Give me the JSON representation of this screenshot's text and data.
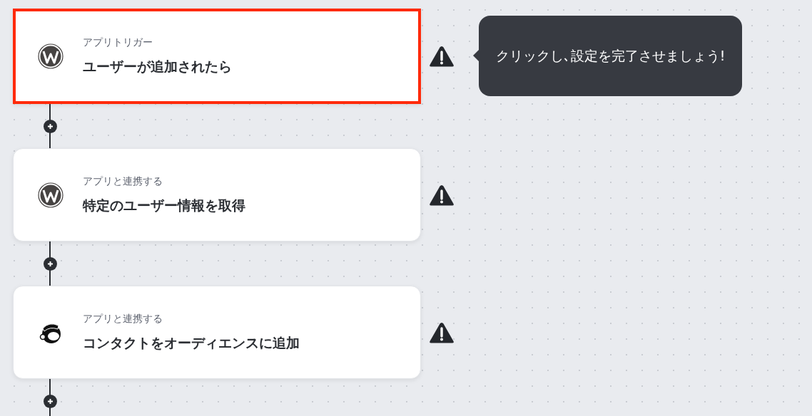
{
  "steps": [
    {
      "kind": "wordpress",
      "label": "アプリトリガー",
      "title": "ユーザーが追加されたら",
      "highlighted": true,
      "warning": true,
      "tooltip": "クリックし､設定を完了させましょう!"
    },
    {
      "kind": "wordpress",
      "label": "アプリと連携する",
      "title": "特定のユーザー情報を取得",
      "highlighted": false,
      "warning": true
    },
    {
      "kind": "mailchimp",
      "label": "アプリと連携する",
      "title": "コンタクトをオーディエンスに追加",
      "highlighted": false,
      "warning": true
    }
  ]
}
